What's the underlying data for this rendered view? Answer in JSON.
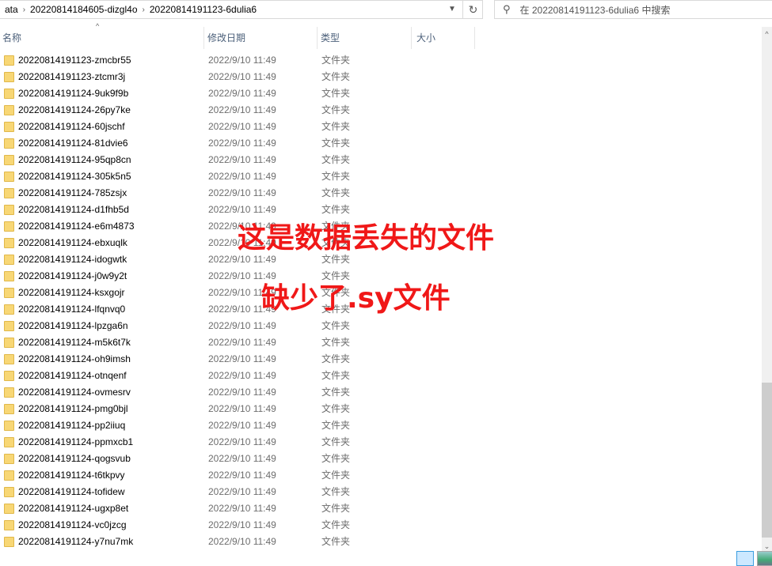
{
  "address": {
    "crumbs": [
      "ata",
      "20220814184605-dizgl4o",
      "20220814191123-6dulia6"
    ]
  },
  "search": {
    "placeholder": "在 20220814191123-6dulia6 中搜索"
  },
  "columns": {
    "name": "名称",
    "date": "修改日期",
    "type": "类型",
    "size": "大小"
  },
  "files": [
    {
      "name": "20220814191123-zmcbr55",
      "date": "2022/9/10 11:49",
      "type": "文件夹"
    },
    {
      "name": "20220814191123-ztcmr3j",
      "date": "2022/9/10 11:49",
      "type": "文件夹"
    },
    {
      "name": "20220814191124-9uk9f9b",
      "date": "2022/9/10 11:49",
      "type": "文件夹"
    },
    {
      "name": "20220814191124-26py7ke",
      "date": "2022/9/10 11:49",
      "type": "文件夹"
    },
    {
      "name": "20220814191124-60jschf",
      "date": "2022/9/10 11:49",
      "type": "文件夹"
    },
    {
      "name": "20220814191124-81dvie6",
      "date": "2022/9/10 11:49",
      "type": "文件夹"
    },
    {
      "name": "20220814191124-95qp8cn",
      "date": "2022/9/10 11:49",
      "type": "文件夹"
    },
    {
      "name": "20220814191124-305k5n5",
      "date": "2022/9/10 11:49",
      "type": "文件夹"
    },
    {
      "name": "20220814191124-785zsjx",
      "date": "2022/9/10 11:49",
      "type": "文件夹"
    },
    {
      "name": "20220814191124-d1fhb5d",
      "date": "2022/9/10 11:49",
      "type": "文件夹"
    },
    {
      "name": "20220814191124-e6m4873",
      "date": "2022/9/10 11:49",
      "type": "文件夹"
    },
    {
      "name": "20220814191124-ebxuqlk",
      "date": "2022/9/10 11:49",
      "type": "文件夹"
    },
    {
      "name": "20220814191124-idogwtk",
      "date": "2022/9/10 11:49",
      "type": "文件夹"
    },
    {
      "name": "20220814191124-j0w9y2t",
      "date": "2022/9/10 11:49",
      "type": "文件夹"
    },
    {
      "name": "20220814191124-ksxgojr",
      "date": "2022/9/10 11:49",
      "type": "文件夹"
    },
    {
      "name": "20220814191124-lfqnvq0",
      "date": "2022/9/10 11:49",
      "type": "文件夹"
    },
    {
      "name": "20220814191124-lpzga6n",
      "date": "2022/9/10 11:49",
      "type": "文件夹"
    },
    {
      "name": "20220814191124-m5k6t7k",
      "date": "2022/9/10 11:49",
      "type": "文件夹"
    },
    {
      "name": "20220814191124-oh9imsh",
      "date": "2022/9/10 11:49",
      "type": "文件夹"
    },
    {
      "name": "20220814191124-otnqenf",
      "date": "2022/9/10 11:49",
      "type": "文件夹"
    },
    {
      "name": "20220814191124-ovmesrv",
      "date": "2022/9/10 11:49",
      "type": "文件夹"
    },
    {
      "name": "20220814191124-pmg0bjl",
      "date": "2022/9/10 11:49",
      "type": "文件夹"
    },
    {
      "name": "20220814191124-pp2iiuq",
      "date": "2022/9/10 11:49",
      "type": "文件夹"
    },
    {
      "name": "20220814191124-ppmxcb1",
      "date": "2022/9/10 11:49",
      "type": "文件夹"
    },
    {
      "name": "20220814191124-qogsvub",
      "date": "2022/9/10 11:49",
      "type": "文件夹"
    },
    {
      "name": "20220814191124-t6tkpvy",
      "date": "2022/9/10 11:49",
      "type": "文件夹"
    },
    {
      "name": "20220814191124-tofidew",
      "date": "2022/9/10 11:49",
      "type": "文件夹"
    },
    {
      "name": "20220814191124-ugxp8et",
      "date": "2022/9/10 11:49",
      "type": "文件夹"
    },
    {
      "name": "20220814191124-vc0jzcg",
      "date": "2022/9/10 11:49",
      "type": "文件夹"
    },
    {
      "name": "20220814191124-y7nu7mk",
      "date": "2022/9/10 11:49",
      "type": "文件夹"
    }
  ],
  "annotation": {
    "line1": "这是数据丢失的文件",
    "line2": "缺少了.sy文件",
    "color": "#f01818"
  }
}
